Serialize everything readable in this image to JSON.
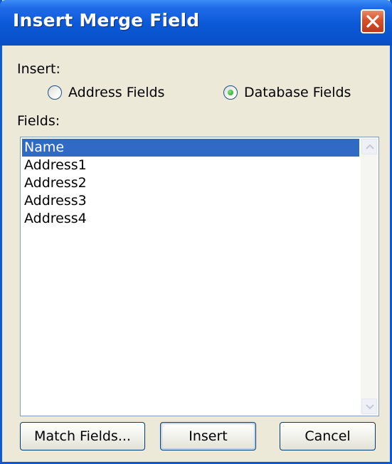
{
  "window": {
    "title": "Insert Merge Field"
  },
  "insert_group": {
    "label": "Insert:",
    "options": [
      {
        "label": "Address Fields",
        "selected": false
      },
      {
        "label": "Database Fields",
        "selected": true
      }
    ]
  },
  "fields": {
    "label": "Fields:",
    "items": [
      "Name",
      "Address1",
      "Address2",
      "Address3",
      "Address4"
    ],
    "selected": "Name"
  },
  "buttons": {
    "match_fields": "Match Fields...",
    "insert": "Insert",
    "cancel": "Cancel"
  },
  "colors": {
    "title_bar": "#0a58d6",
    "selection": "#316ac5",
    "dialog_face": "#ece9d8",
    "radio_check": "#21a121"
  }
}
